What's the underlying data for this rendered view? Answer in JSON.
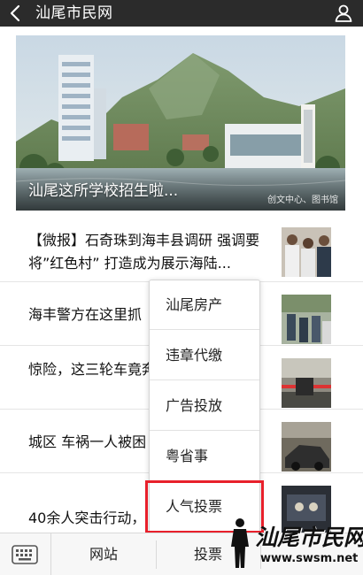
{
  "header": {
    "title": "汕尾市民网",
    "back_icon": "chevron-left-icon",
    "user_icon": "person-icon"
  },
  "banner": {
    "caption": "汕尾这所学校招生啦...",
    "watermark": "创文中心、图书馆"
  },
  "news": [
    {
      "text": "【微报】石奇珠到海丰县调研 强调要将”红色村” 打造成为展示海陆..."
    },
    {
      "text": "海丰警方在这里抓"
    },
    {
      "text": "惊险，这三轮车竟奔..."
    },
    {
      "text": "城区 车祸一人被困"
    },
    {
      "text": "40余人突击行动，"
    }
  ],
  "popup_menu": {
    "items": [
      "汕尾房产",
      "违章代缴",
      "广告投放",
      "粤省事",
      "人气投票"
    ],
    "highlighted": "人气投票",
    "highlight_color": "#e8202b"
  },
  "bottom_bar": {
    "keyboard_icon": "keyboard-icon",
    "tabs": [
      "网站",
      "投票"
    ]
  },
  "logo": {
    "brand": "汕尾市民网",
    "url": "www.swsm.net"
  }
}
